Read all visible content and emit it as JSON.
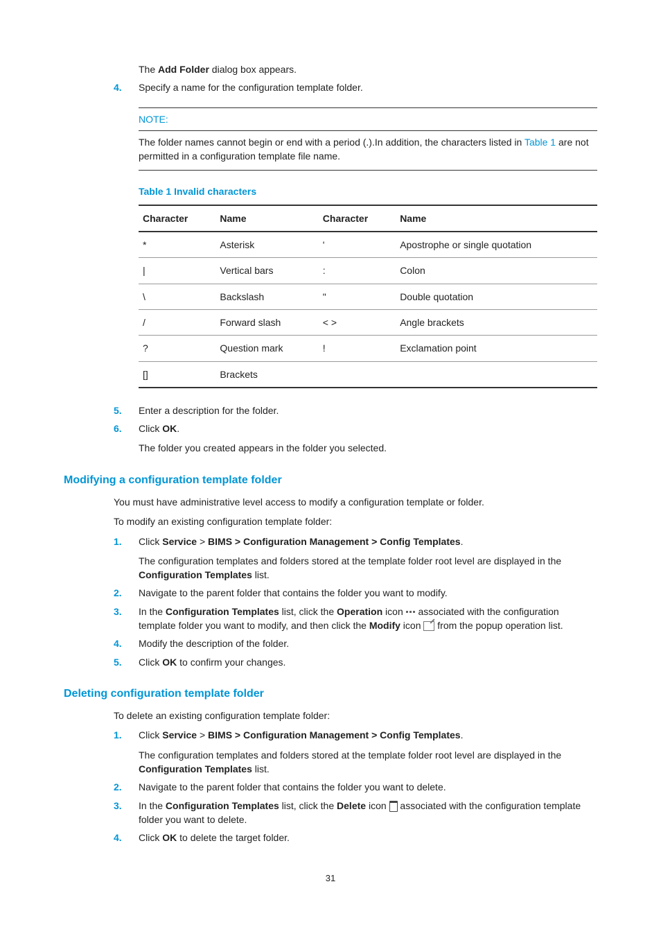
{
  "intro": {
    "line1_pre": "The ",
    "line1_bold": "Add Folder",
    "line1_post": " dialog box appears."
  },
  "step4": {
    "num": "4.",
    "text": "Specify a name for the configuration template folder."
  },
  "note": {
    "title": "NOTE:",
    "body_pre": "The folder names cannot begin or end with a period (.).In addition, the characters listed in ",
    "body_link": "Table 1",
    "body_post": " are not permitted in a configuration template file name."
  },
  "tableCaption": "Table 1 Invalid characters",
  "tableHeaders": {
    "c1": "Character",
    "n1": "Name",
    "c2": "Character",
    "n2": "Name"
  },
  "tableRows": [
    {
      "c1": "*",
      "n1": "Asterisk",
      "c2": "'",
      "n2": "Apostrophe or single quotation"
    },
    {
      "c1": "|",
      "n1": "Vertical bars",
      "c2": ":",
      "n2": "Colon"
    },
    {
      "c1": "\\",
      "n1": "Backslash",
      "c2": "\"",
      "n2": "Double quotation"
    },
    {
      "c1": "/",
      "n1": "Forward slash",
      "c2": "< >",
      "n2": "Angle brackets"
    },
    {
      "c1": "?",
      "n1": "Question mark",
      "c2": "!",
      "n2": "Exclamation point"
    },
    {
      "c1": "[]",
      "n1": "Brackets",
      "c2": "",
      "n2": ""
    }
  ],
  "step5": {
    "num": "5.",
    "text": "Enter a description for the folder."
  },
  "step6": {
    "num": "6.",
    "pre": "Click ",
    "bold": "OK",
    "post": ".",
    "follow": "The folder you created appears in the folder you selected."
  },
  "modSection": {
    "title": "Modifying a configuration template folder",
    "p1": "You must have administrative level access to modify a configuration template or folder.",
    "p2": "To modify an existing configuration template folder:",
    "s1": {
      "num": "1.",
      "t1": "Click ",
      "b1": "Service",
      "t2": " > ",
      "b2": "BIMS > Configuration Management > Config Templates",
      "t3": ".",
      "follow_pre": "The configuration templates and folders stored at the template folder root level are displayed in the ",
      "follow_bold": "Configuration Templates",
      "follow_post": " list."
    },
    "s2": {
      "num": "2.",
      "text": "Navigate to the parent folder that contains the folder you want to modify."
    },
    "s3": {
      "num": "3.",
      "t1": "In the ",
      "b1": "Configuration Templates",
      "t2": " list, click the ",
      "b2": "Operation",
      "t3": " icon ",
      "t4": " associated with the configuration template folder you want to modify, and then click the ",
      "b3": "Modify",
      "t5": " icon ",
      "t6": " from the popup operation list."
    },
    "s4": {
      "num": "4.",
      "text": "Modify the description of the folder."
    },
    "s5": {
      "num": "5.",
      "t1": "Click ",
      "b1": "OK",
      "t2": " to confirm your changes."
    }
  },
  "delSection": {
    "title": "Deleting configuration template folder",
    "p1": "To delete an existing configuration template folder:",
    "s1": {
      "num": "1.",
      "t1": "Click ",
      "b1": "Service",
      "t2": " > ",
      "b2": "BIMS > Configuration Management > Config Templates",
      "t3": ".",
      "follow_pre": "The configuration templates and folders stored at the template folder root level are displayed in the ",
      "follow_bold": "Configuration Templates",
      "follow_post": " list."
    },
    "s2": {
      "num": "2.",
      "text": "Navigate to the parent folder that contains the folder you want to delete."
    },
    "s3": {
      "num": "3.",
      "t1": "In the ",
      "b1": "Configuration Templates",
      "t2": " list, click the ",
      "b2": "Delete",
      "t3": " icon ",
      "t4": " associated with the configuration template folder you want to delete."
    },
    "s4": {
      "num": "4.",
      "t1": "Click ",
      "b1": "OK",
      "t2": " to delete the target folder."
    }
  },
  "pageNum": "31"
}
